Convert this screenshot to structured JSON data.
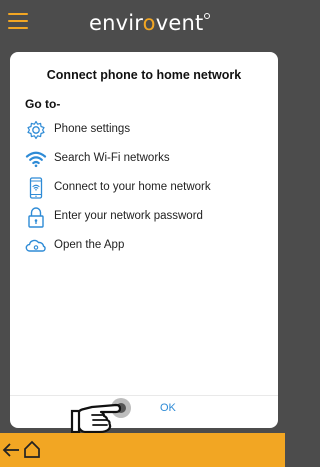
{
  "header": {
    "logo_white_1": "envir",
    "logo_orange": "o",
    "logo_white_2": "vent"
  },
  "dialog": {
    "title": "Connect phone to home network",
    "goto_label": "Go to-",
    "steps": [
      {
        "icon": "gear-icon",
        "label": "Phone settings"
      },
      {
        "icon": "wifi-icon",
        "label": "Search Wi-Fi networks"
      },
      {
        "icon": "phone-wifi-icon",
        "label": "Connect to your home network"
      },
      {
        "icon": "lock-icon",
        "label": "Enter your network password"
      },
      {
        "icon": "cloud-icon",
        "label": "Open the App"
      }
    ],
    "ok_label": "OK"
  },
  "colors": {
    "accent": "#f2a623",
    "header_bg": "#4c4c4c",
    "link_blue": "#2e8bd6"
  }
}
